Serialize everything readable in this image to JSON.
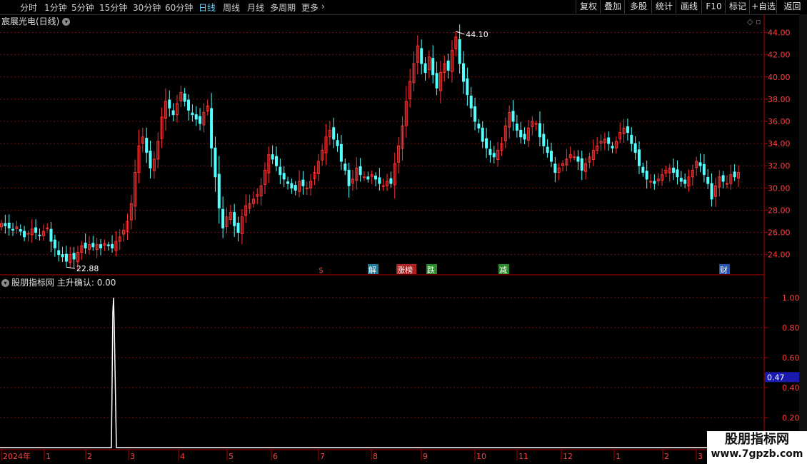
{
  "toolbar": {
    "periods": [
      "分时",
      "1分钟",
      "5分钟",
      "15分钟",
      "30分钟",
      "60分钟",
      "日线",
      "周线",
      "月线",
      "多周期",
      "更多"
    ],
    "active_period": "日线",
    "right_buttons": [
      "复权",
      "叠加",
      "多股",
      "统计",
      "画线",
      "F10",
      "标记",
      "+自选",
      "返回"
    ]
  },
  "price_panel": {
    "title": "宸展光电(日线)"
  },
  "indicator_panel": {
    "name": "股朋指标网",
    "series_label": "主升确认: 0.00"
  },
  "colors": {
    "up": "#ff3232",
    "down": "#54ffff",
    "grid": "#7a1010",
    "axis": "#b00000",
    "label": "#ff4040",
    "highlight_bg": "#1a1ab0"
  },
  "chart_data": [
    {
      "type": "candlestick",
      "ylim": [
        22.5,
        45
      ],
      "yticks": [
        24.0,
        26.0,
        28.0,
        30.0,
        32.0,
        34.0,
        36.0,
        38.0,
        40.0,
        42.0,
        44.0
      ],
      "ytick_labels": [
        "24.00",
        "26.00",
        "28.00",
        "30.00",
        "32.00",
        "34.00",
        "36.00",
        "38.00",
        "40.00",
        "42.00",
        "44.00"
      ],
      "annotations": [
        {
          "label": "44.10",
          "value": 44.1
        },
        {
          "label": "22.88",
          "value": 22.88
        }
      ],
      "event_markers": [
        {
          "label": "$",
          "color": "#ff3030"
        },
        {
          "label": "解",
          "color": "#ffffff",
          "bg": "#1e7a9a"
        },
        {
          "label": "涨榜",
          "color": "#ffffff",
          "bg": "#b02020"
        },
        {
          "label": "跌",
          "color": "#ffffff",
          "bg": "#2a8a2a"
        },
        {
          "label": "减",
          "color": "#ffffff",
          "bg": "#2a8a2a"
        },
        {
          "label": "财",
          "color": "#ffffff",
          "bg": "#2050b0"
        }
      ],
      "close_values": [
        26.8,
        26.6,
        26.4,
        26.2,
        26.5,
        26.1,
        25.6,
        25.9,
        26.3,
        26.0,
        25.7,
        26.1,
        26.4,
        25.2,
        24.6,
        24.0,
        23.8,
        23.4,
        24.0,
        23.6,
        24.2,
        24.8,
        24.6,
        24.9,
        24.7,
        24.9,
        24.6,
        25.0,
        24.8,
        24.6,
        25.2,
        25.6,
        26.2,
        27.0,
        28.6,
        31.4,
        33.8,
        34.6,
        33.2,
        31.8,
        32.6,
        34.2,
        36.4,
        37.8,
        37.2,
        36.6,
        37.6,
        38.6,
        37.8,
        37.0,
        36.6,
        36.2,
        35.8,
        36.8,
        37.4,
        33.6,
        31.0,
        28.2,
        26.4,
        27.4,
        27.8,
        26.6,
        26.0,
        27.4,
        28.4,
        28.6,
        29.0,
        29.4,
        30.2,
        31.6,
        33.0,
        32.6,
        32.0,
        31.2,
        30.8,
        30.4,
        30.0,
        29.8,
        30.6,
        30.2,
        30.0,
        30.6,
        31.4,
        32.4,
        33.4,
        34.6,
        35.2,
        34.4,
        33.8,
        32.4,
        31.6,
        30.2,
        30.8,
        31.8,
        31.2,
        31.0,
        30.8,
        31.2,
        30.8,
        30.4,
        30.2,
        30.6,
        30.4,
        32.2,
        33.8,
        35.6,
        37.8,
        39.6,
        41.2,
        42.8,
        41.2,
        40.4,
        41.8,
        40.2,
        39.0,
        40.4,
        41.2,
        40.6,
        42.4,
        43.6,
        41.2,
        39.6,
        38.4,
        37.2,
        36.0,
        35.4,
        34.2,
        33.6,
        33.0,
        32.8,
        33.4,
        34.0,
        35.6,
        36.8,
        36.0,
        35.2,
        34.6,
        34.4,
        35.4,
        36.0,
        35.8,
        34.6,
        33.8,
        33.2,
        32.4,
        31.4,
        31.8,
        32.2,
        32.6,
        33.0,
        32.8,
        32.4,
        31.6,
        32.2,
        32.8,
        33.4,
        33.8,
        34.2,
        34.4,
        34.0,
        33.6,
        34.2,
        35.0,
        35.4,
        35.0,
        34.0,
        33.2,
        32.0,
        31.4,
        30.8,
        30.6,
        30.4,
        30.8,
        31.2,
        31.6,
        31.8,
        31.4,
        31.0,
        30.6,
        30.4,
        31.0,
        31.6,
        32.4,
        32.0,
        31.2,
        30.4,
        29.0,
        30.2,
        31.0,
        30.6,
        30.4,
        31.2,
        31.0,
        31.4
      ]
    },
    {
      "type": "line",
      "series": [
        {
          "name": "主升确认",
          "peak_value": 1.0,
          "baseline_value": 0.0
        }
      ],
      "ylim": [
        0,
        1.1
      ],
      "yticks": [
        0.2,
        0.4,
        0.6,
        0.8,
        1.0
      ],
      "ytick_labels": [
        "0.20",
        "0.40",
        "0.60",
        "0.80",
        "1.00"
      ],
      "cursor_value_label": "0.47"
    }
  ],
  "x_axis": {
    "labels": [
      "2024年",
      "1",
      "2",
      "3",
      "4",
      "5",
      "6",
      "7",
      "8",
      "9",
      "10",
      "11",
      "12",
      "1",
      "2",
      "3"
    ]
  },
  "watermark": {
    "title": "股朋指标网",
    "url": "www.7gpzb.com"
  }
}
